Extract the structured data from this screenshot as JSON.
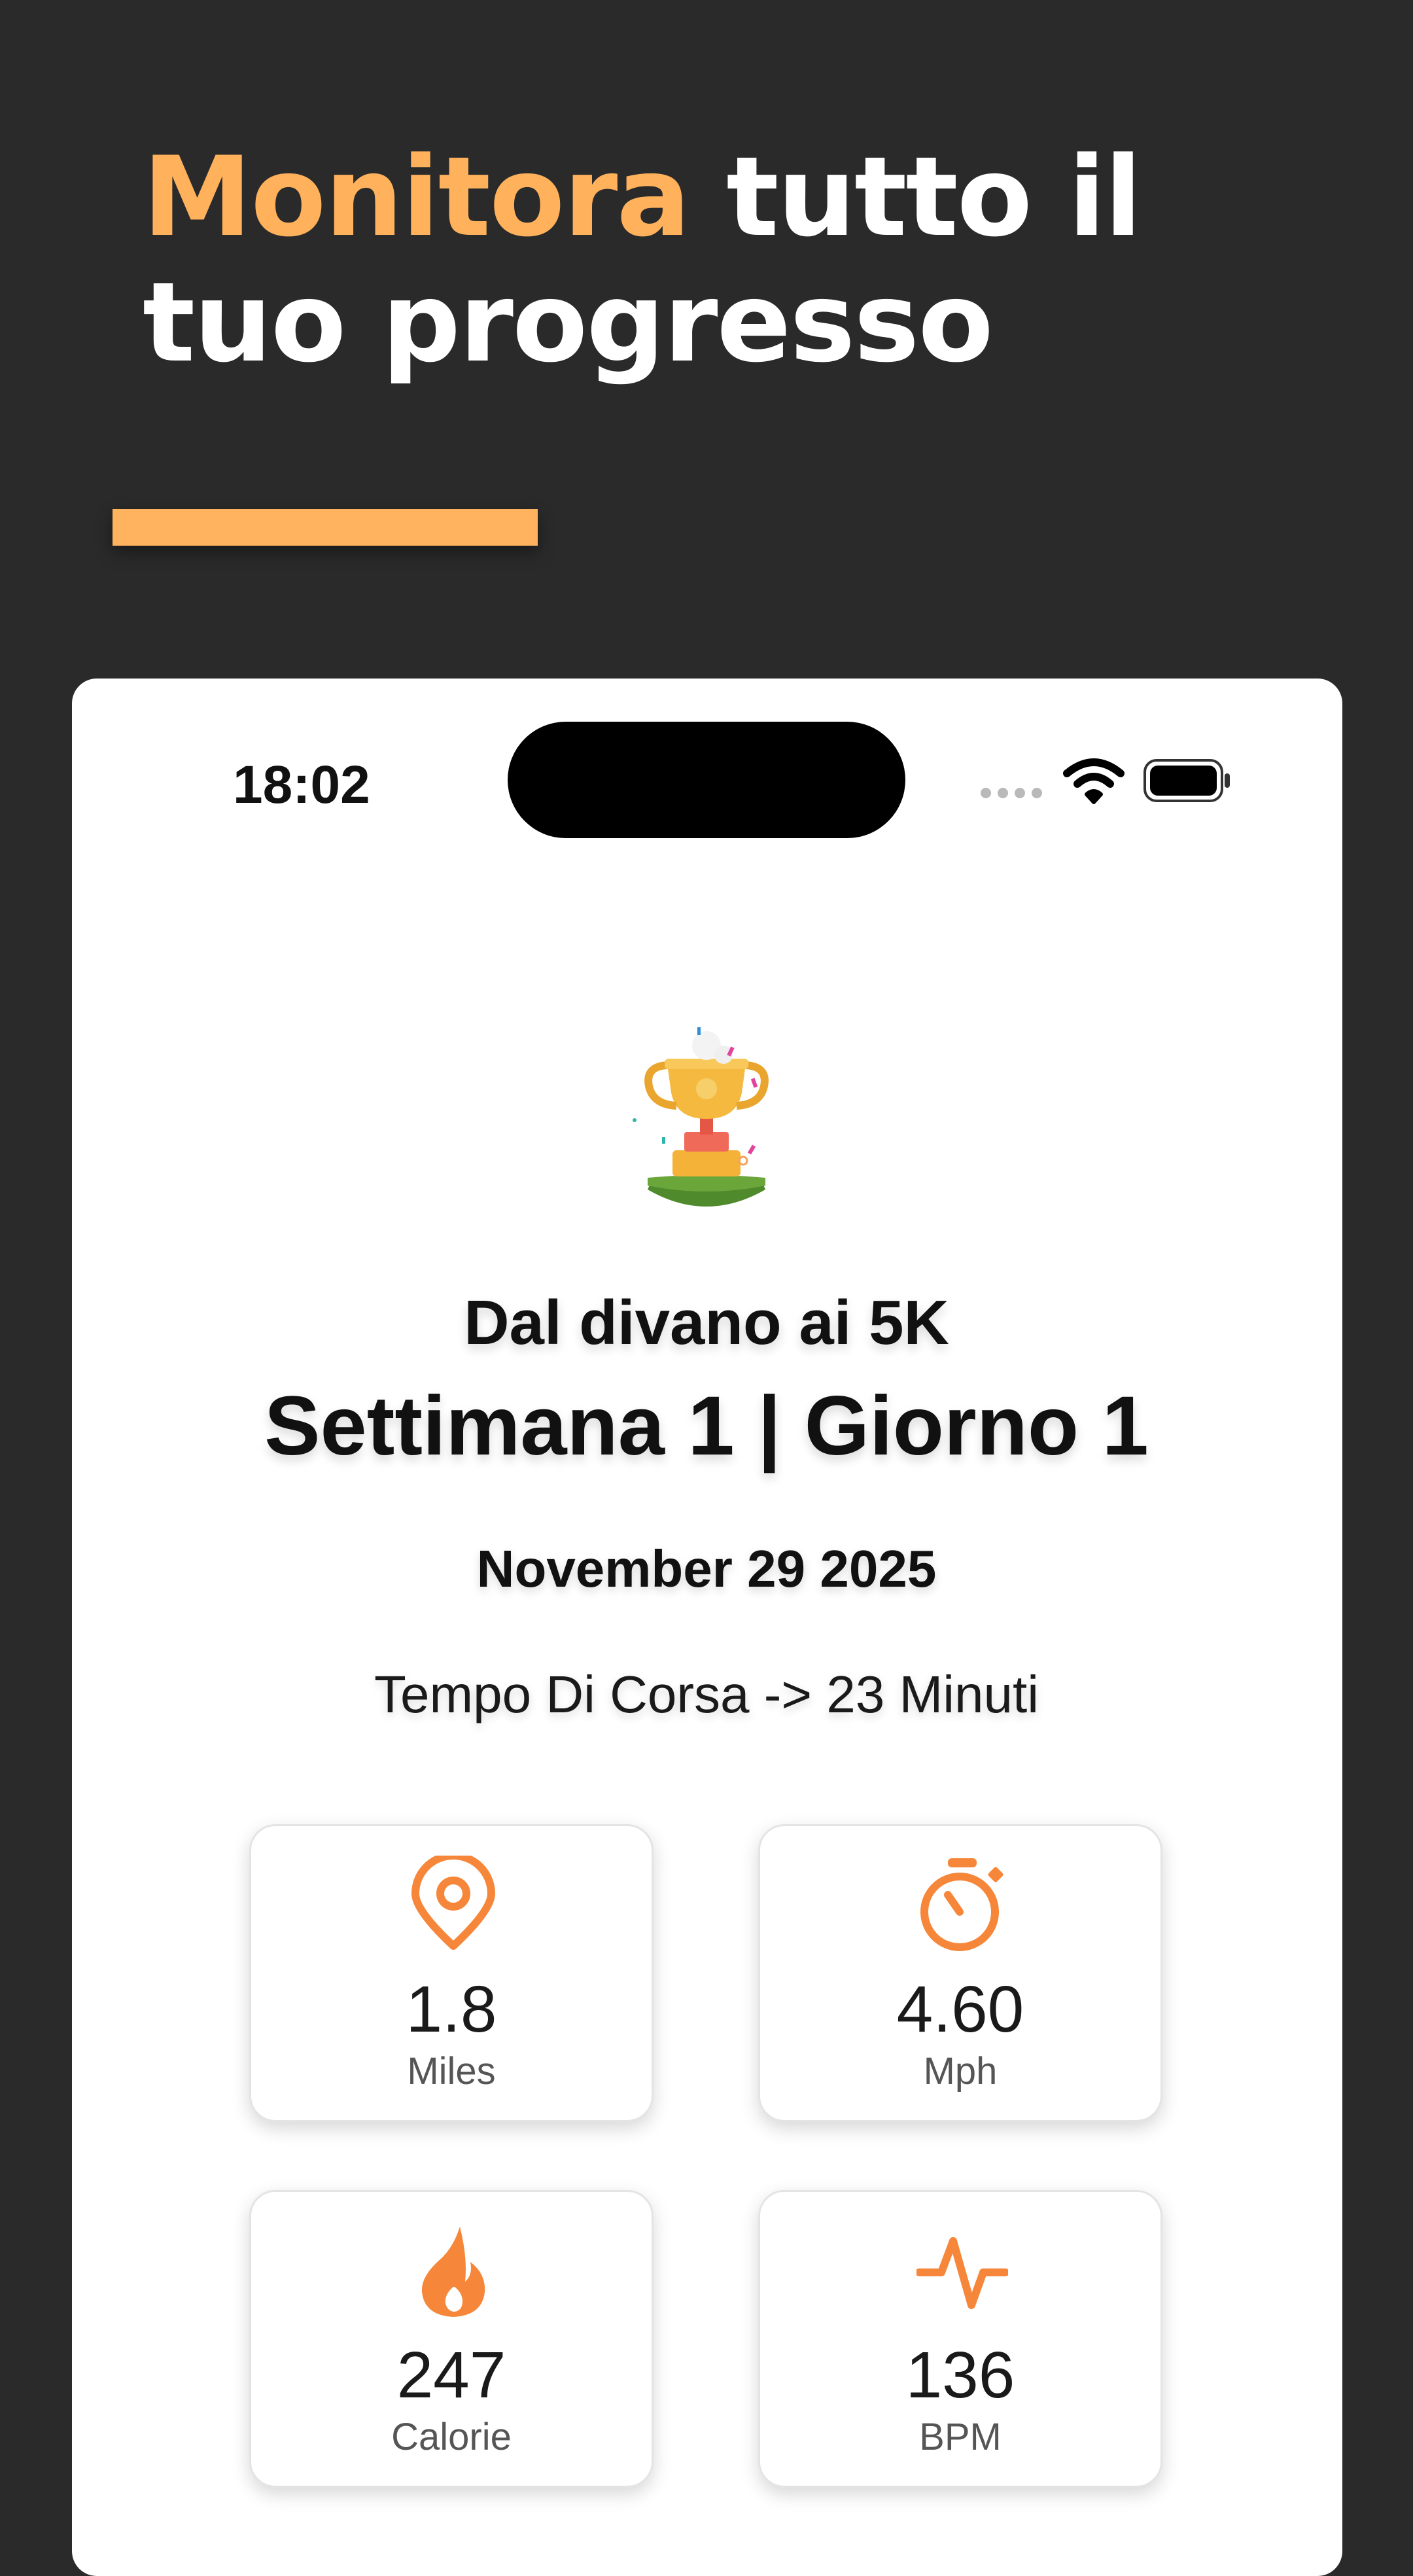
{
  "header": {
    "headline_accent": "Monitora",
    "headline_line1_rest": " tutto il",
    "headline_line2": "tuo progresso"
  },
  "colors": {
    "accent": "#ffb15c",
    "icon_orange": "#f6873a",
    "background": "#2a2a2a",
    "card": "#ffffff"
  },
  "status_bar": {
    "time": "18:02"
  },
  "workout": {
    "program": "Dal divano ai 5K",
    "session": "Settimana 1 | Giorno 1",
    "date": "November 29 2025",
    "run_time": "Tempo Di Corsa -> 23 Minuti"
  },
  "stats": [
    {
      "icon": "location-pin-icon",
      "value": "1.8",
      "unit": "Miles"
    },
    {
      "icon": "stopwatch-icon",
      "value": "4.60",
      "unit": "Mph"
    },
    {
      "icon": "flame-icon",
      "value": "247",
      "unit": "Calorie"
    },
    {
      "icon": "heart-rate-icon",
      "value": "136",
      "unit": "BPM"
    }
  ]
}
